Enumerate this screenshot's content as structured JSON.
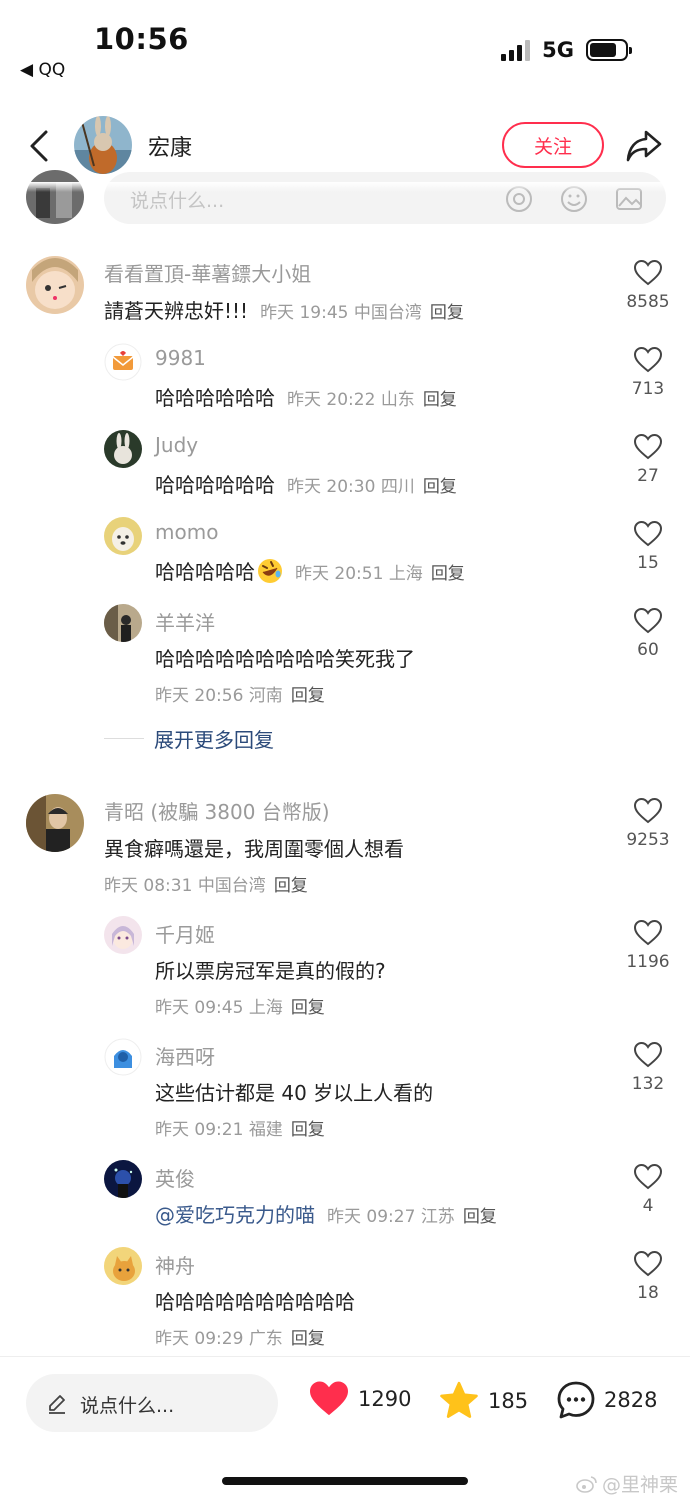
{
  "status_bar": {
    "time": "10:56",
    "back_app": "◀ QQ",
    "network": "5G",
    "battery_level": 0.75
  },
  "header": {
    "author_name": "宏康",
    "follow_label": "关注"
  },
  "comment_box": {
    "placeholder": "说点什么..."
  },
  "comments": [
    {
      "user": "看看置頂-華薯鏢大小姐",
      "text": "請蒼天辨忠奸!!!",
      "time": "昨天 19:45",
      "location": "中国台湾",
      "reply_label": "回复",
      "likes": "8585",
      "replies": [
        {
          "user": "9981",
          "text": "哈哈哈哈哈哈",
          "time": "昨天 20:22",
          "location": "山东",
          "reply_label": "回复",
          "likes": "713"
        },
        {
          "user": "Judy",
          "text": "哈哈哈哈哈哈",
          "time": "昨天 20:30",
          "location": "四川",
          "reply_label": "回复",
          "likes": "27"
        },
        {
          "user": "momo",
          "text": "哈哈哈哈哈",
          "emoji": "rolling-laughing-emoji",
          "time": "昨天 20:51",
          "location": "上海",
          "reply_label": "回复",
          "likes": "15"
        },
        {
          "user": "羊羊洋",
          "text": "哈哈哈哈哈哈哈哈哈笑死我了",
          "time": "昨天 20:56",
          "location": "河南",
          "reply_label": "回复",
          "likes": "60"
        }
      ],
      "expand_label": "展开更多回复"
    },
    {
      "user": "青昭 (被騙 3800 台幣版)",
      "text": "異食癖嗎還是，我周圍零個人想看",
      "time": "昨天 08:31",
      "location": "中国台湾",
      "reply_label": "回复",
      "likes": "9253",
      "replies": [
        {
          "user": "千月姬",
          "text": "所以票房冠军是真的假的?",
          "time": "昨天 09:45",
          "location": "上海",
          "reply_label": "回复",
          "likes": "1196"
        },
        {
          "user": "海西呀",
          "text": "这些估计都是 40 岁以上人看的",
          "time": "昨天 09:21",
          "location": "福建",
          "reply_label": "回复",
          "likes": "132"
        },
        {
          "user": "英俊",
          "text": "@爱吃巧克力的喵",
          "time": "昨天 09:27",
          "location": "江苏",
          "reply_label": "回复",
          "likes": "4"
        },
        {
          "user": "神舟",
          "text": "哈哈哈哈哈哈哈哈哈哈",
          "time": "昨天 09:29",
          "location": "广东",
          "reply_label": "回复",
          "likes": "18"
        }
      ]
    }
  ],
  "bottom_bar": {
    "input_placeholder": "说点什么...",
    "likes": "1290",
    "favorites": "185",
    "comments": "2828"
  },
  "watermark": "@里神栗",
  "colors": {
    "accent_red": "#ff2e4d",
    "star_yellow": "#ffc21a",
    "link_blue": "#2b4a7a"
  }
}
